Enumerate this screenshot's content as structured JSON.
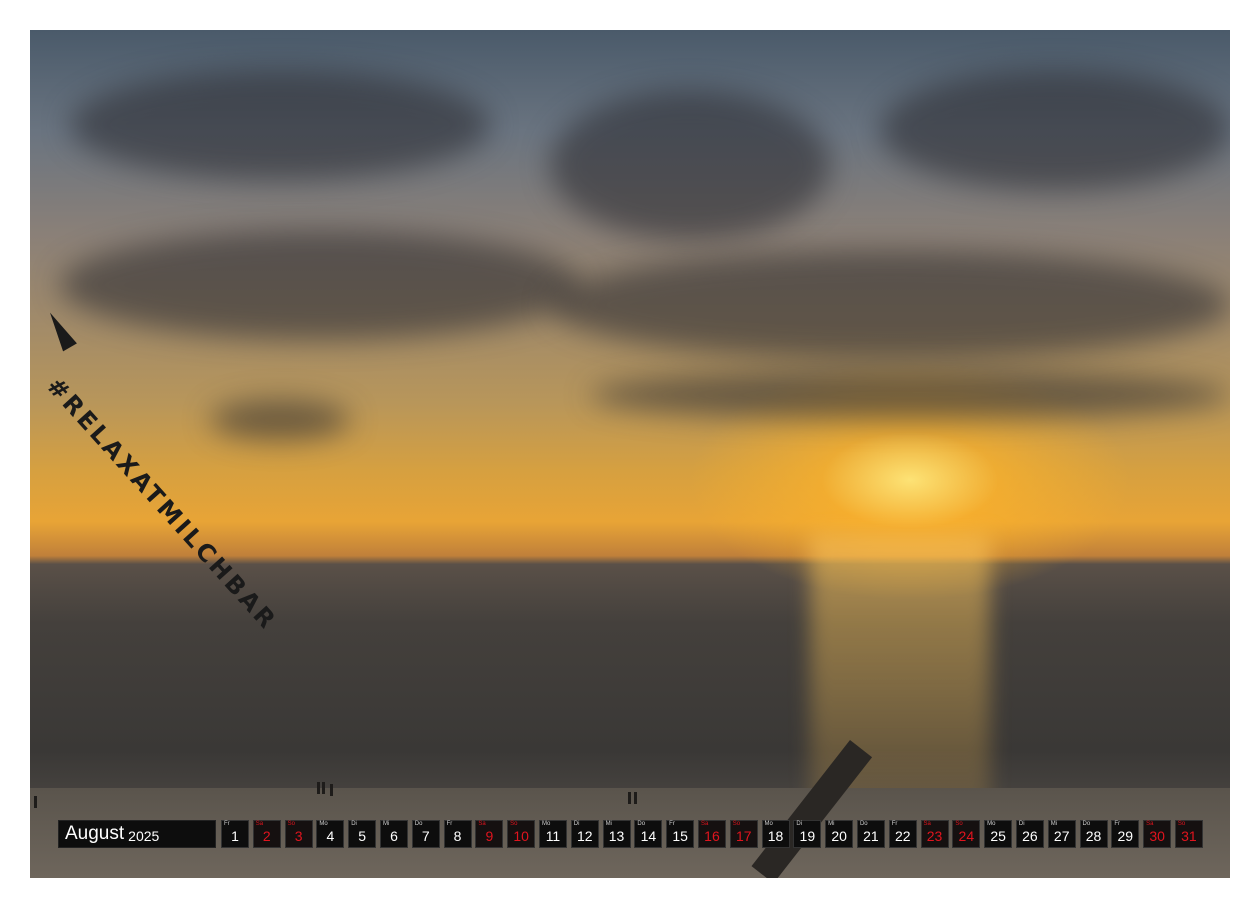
{
  "banner": {
    "hashtag": "#RELAXATMILCHBAR"
  },
  "calendar": {
    "month": "August",
    "year": "2025",
    "weekend_color": "#e0141e",
    "days": [
      {
        "wd": "Fr",
        "num": "1",
        "we": false
      },
      {
        "wd": "Sa",
        "num": "2",
        "we": true
      },
      {
        "wd": "So",
        "num": "3",
        "we": true
      },
      {
        "wd": "Mo",
        "num": "4",
        "we": false
      },
      {
        "wd": "Di",
        "num": "5",
        "we": false
      },
      {
        "wd": "Mi",
        "num": "6",
        "we": false
      },
      {
        "wd": "Do",
        "num": "7",
        "we": false
      },
      {
        "wd": "Fr",
        "num": "8",
        "we": false
      },
      {
        "wd": "Sa",
        "num": "9",
        "we": true
      },
      {
        "wd": "So",
        "num": "10",
        "we": true
      },
      {
        "wd": "Mo",
        "num": "11",
        "we": false
      },
      {
        "wd": "Di",
        "num": "12",
        "we": false
      },
      {
        "wd": "Mi",
        "num": "13",
        "we": false
      },
      {
        "wd": "Do",
        "num": "14",
        "we": false
      },
      {
        "wd": "Fr",
        "num": "15",
        "we": false
      },
      {
        "wd": "Sa",
        "num": "16",
        "we": true
      },
      {
        "wd": "So",
        "num": "17",
        "we": true
      },
      {
        "wd": "Mo",
        "num": "18",
        "we": false
      },
      {
        "wd": "Di",
        "num": "19",
        "we": false
      },
      {
        "wd": "Mi",
        "num": "20",
        "we": false
      },
      {
        "wd": "Do",
        "num": "21",
        "we": false
      },
      {
        "wd": "Fr",
        "num": "22",
        "we": false
      },
      {
        "wd": "Sa",
        "num": "23",
        "we": true
      },
      {
        "wd": "So",
        "num": "24",
        "we": true
      },
      {
        "wd": "Mo",
        "num": "25",
        "we": false
      },
      {
        "wd": "Di",
        "num": "26",
        "we": false
      },
      {
        "wd": "Mi",
        "num": "27",
        "we": false
      },
      {
        "wd": "Do",
        "num": "28",
        "we": false
      },
      {
        "wd": "Fr",
        "num": "29",
        "we": false
      },
      {
        "wd": "Sa",
        "num": "30",
        "we": true
      },
      {
        "wd": "So",
        "num": "31",
        "we": true
      }
    ]
  }
}
